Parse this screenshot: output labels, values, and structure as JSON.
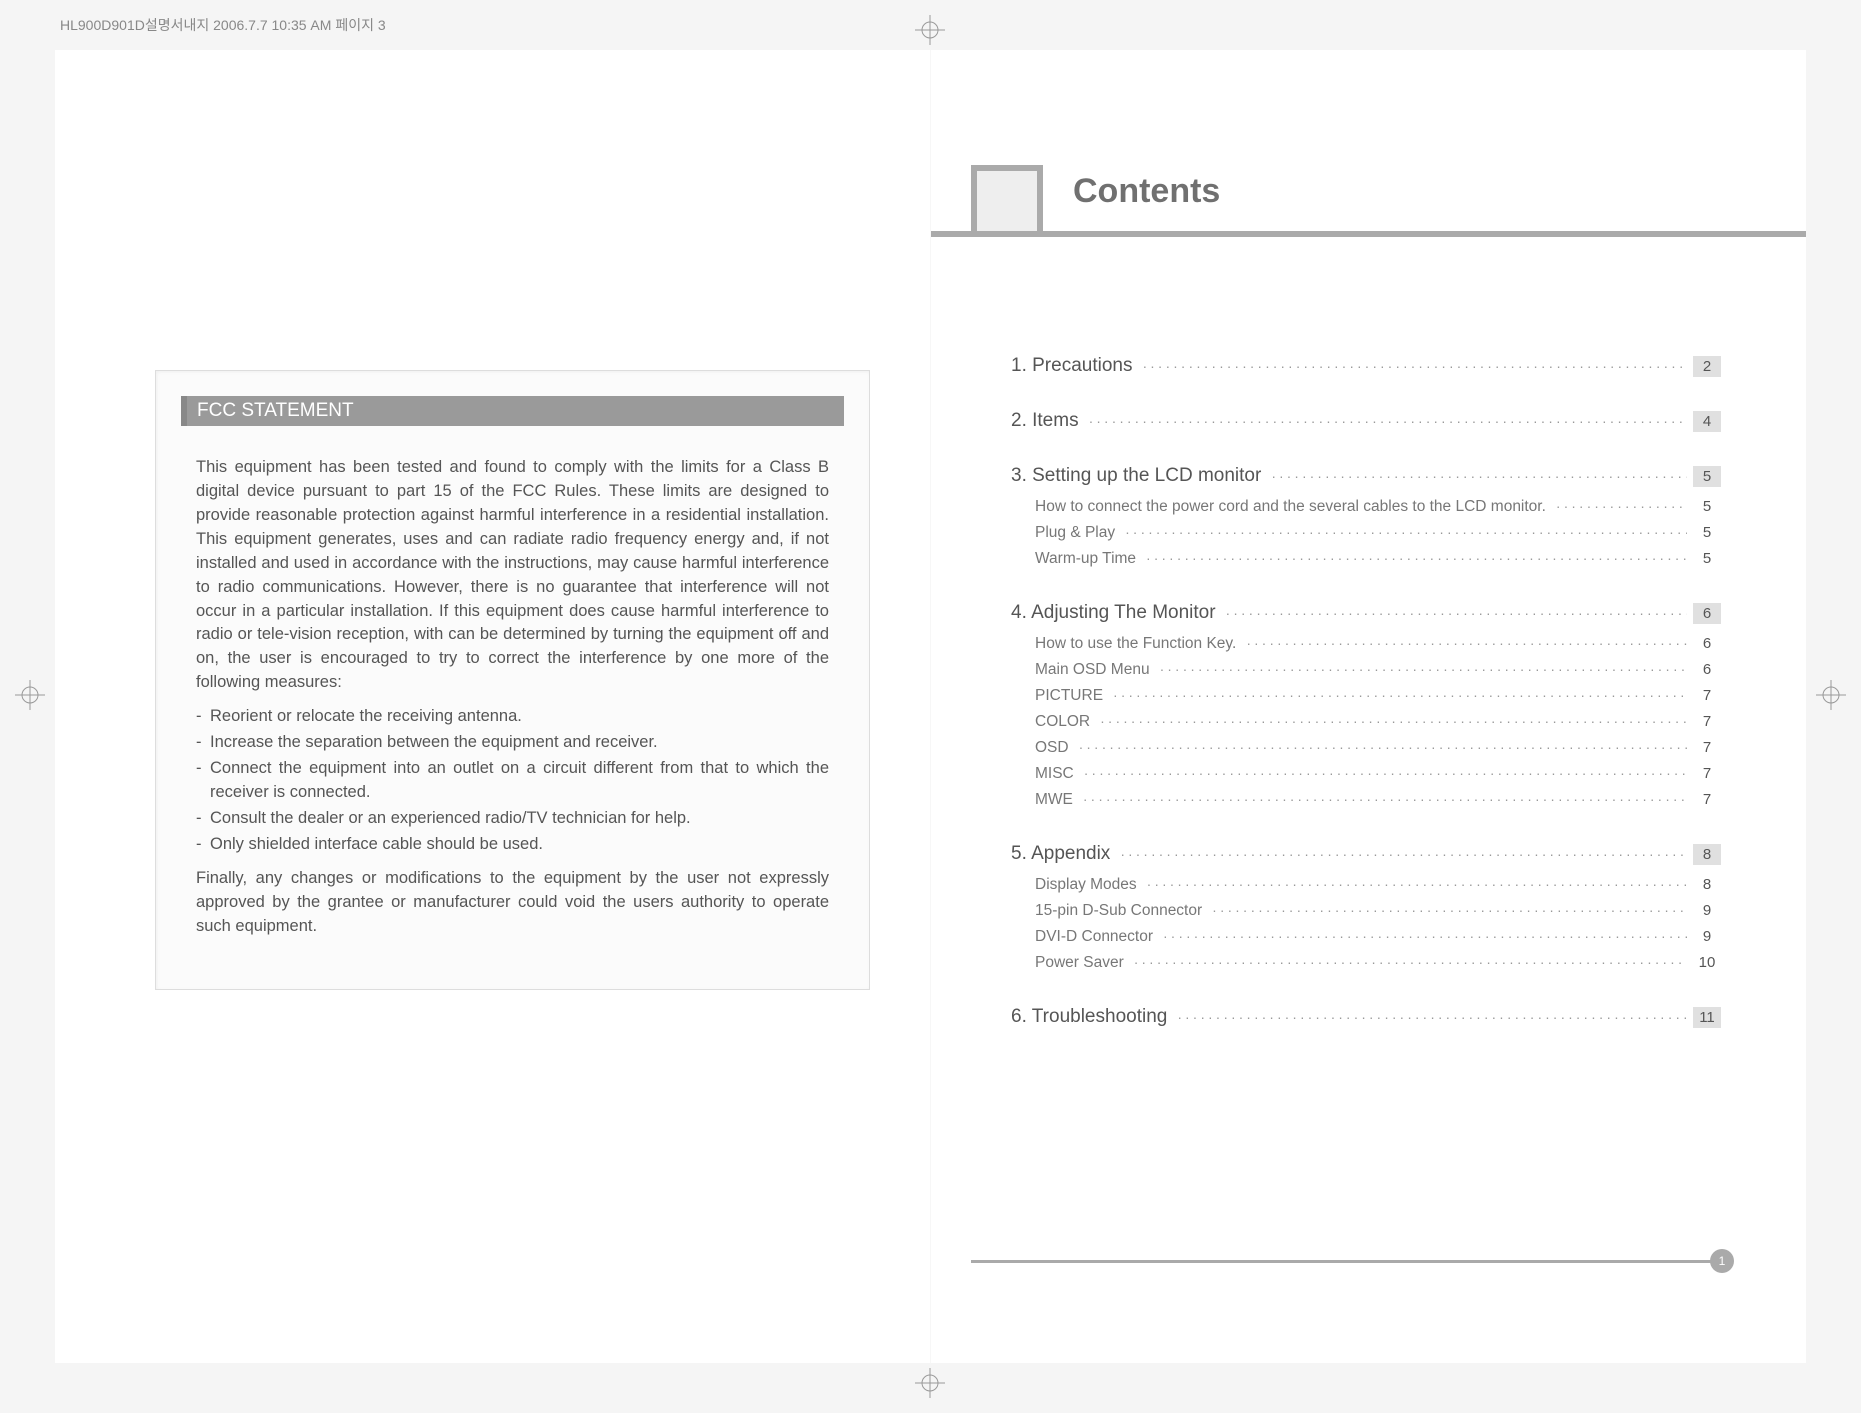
{
  "header_text": "HL900D901D설명서내지   2006.7.7 10:35 AM   페이지 3",
  "left_page": {
    "box_title": "FCC STATEMENT",
    "intro": "This equipment has been tested and found to comply with the limits for a Class B digital device pursuant to part 15 of the FCC Rules. These limits are designed to provide reasonable protection against harmful interference in a residential installation. This equipment generates, uses and can radiate radio frequency energy and, if not installed and used in accordance with the instructions, may cause harmful interference to radio communications. However, there is no guarantee that interference will not occur in a particular installation. If this equipment does cause harmful interference to radio or tele-vision reception, with can be determined by turning the equipment off and on, the user is encouraged to try to correct the interference by one more of the following measures:",
    "bullets": [
      "Reorient or relocate the receiving antenna.",
      "Increase the separation between the equipment and receiver.",
      "Connect the equipment into an outlet on a circuit different from that to which the receiver is connected.",
      "Consult the dealer or an experienced radio/TV technician for help.",
      "Only shielded interface cable should be used."
    ],
    "outro": "Finally, any changes or modifications to the equipment by the user not expressly approved by the grantee or manufacturer could void the users authority to operate such equipment."
  },
  "right_page": {
    "title": "Contents",
    "page_number": "1",
    "toc": [
      {
        "type": "section",
        "label": "1. Precautions",
        "page": "2"
      },
      {
        "type": "section",
        "label": "2. Items",
        "page": "4"
      },
      {
        "type": "section",
        "label": "3. Setting up the LCD monitor",
        "page": "5"
      },
      {
        "type": "sub",
        "label": "How to connect the power cord and the several cables to the LCD monitor.",
        "page": "5"
      },
      {
        "type": "sub",
        "label": "Plug & Play",
        "page": "5"
      },
      {
        "type": "sub",
        "label": "Warm-up Time",
        "page": "5"
      },
      {
        "type": "section",
        "label": "4. Adjusting The Monitor",
        "page": "6"
      },
      {
        "type": "sub",
        "label": "How to use the Function Key.",
        "page": "6"
      },
      {
        "type": "sub",
        "label": "Main OSD Menu",
        "page": "6"
      },
      {
        "type": "sub",
        "label": "PICTURE",
        "page": "7"
      },
      {
        "type": "sub",
        "label": "COLOR",
        "page": "7"
      },
      {
        "type": "sub",
        "label": "OSD",
        "page": "7"
      },
      {
        "type": "sub",
        "label": "MISC",
        "page": "7"
      },
      {
        "type": "sub",
        "label": "MWE",
        "page": "7"
      },
      {
        "type": "section",
        "label": "5. Appendix",
        "page": "8"
      },
      {
        "type": "sub",
        "label": "Display Modes",
        "page": "8"
      },
      {
        "type": "sub",
        "label": "15-pin D-Sub Connector",
        "page": "9"
      },
      {
        "type": "sub",
        "label": "DVI-D Connector",
        "page": "9"
      },
      {
        "type": "sub",
        "label": "Power Saver",
        "page": "10"
      },
      {
        "type": "section",
        "label": "6. Troubleshooting",
        "page": "11"
      }
    ]
  }
}
